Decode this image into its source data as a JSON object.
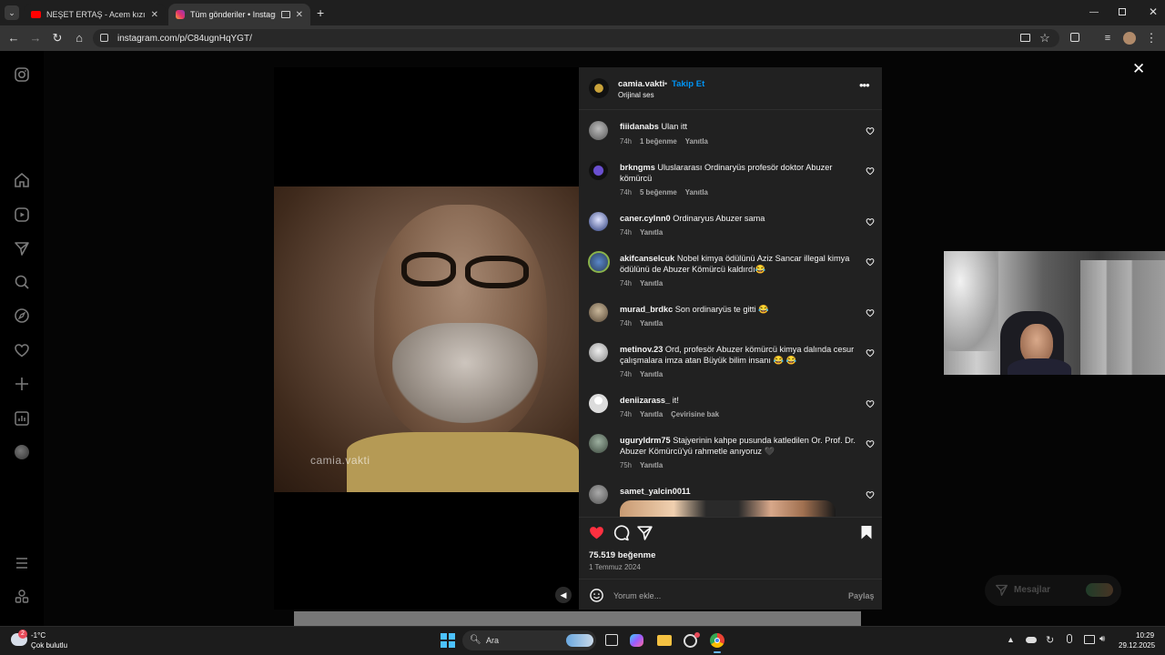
{
  "browser": {
    "tabs": [
      {
        "title": "NEŞET ERTAŞ - Acem kızı, Çırpın",
        "active": false
      },
      {
        "title": "Tüm gönderiler • Instagram",
        "active": true
      }
    ],
    "new_tab": "+",
    "url": "instagram.com/p/C84ugnHqYGT/"
  },
  "post": {
    "username": "camia.vakti",
    "separator": "•",
    "follow": "Takip Et",
    "audio": "Orijinal ses",
    "watermark": "camia.vakti",
    "likes": "75.519 beğenme",
    "date": "1 Temmuz 2024",
    "comment_placeholder": "Yorum ekle...",
    "share": "Paylaş"
  },
  "comments": [
    {
      "user": "fiiidanabs",
      "text": "Ulan itt",
      "time": "74h",
      "likes": "1 beğenme",
      "reply": "Yanıtla"
    },
    {
      "user": "brkngms",
      "text": "Uluslararası Ordinaryüs profesör doktor Abuzer kömürcü",
      "time": "74h",
      "likes": "5 beğenme",
      "reply": "Yanıtla"
    },
    {
      "user": "caner.cylnn0",
      "text": "Ordinaryus Abuzer sama",
      "time": "74h",
      "reply": "Yanıtla"
    },
    {
      "user": "akifcanselcuk",
      "text": "Nobel kimya ödülünü Aziz Sancar illegal kimya ödülünü de Abuzer Kömürcü kaldırdı😂",
      "time": "74h",
      "reply": "Yanıtla"
    },
    {
      "user": "murad_brdkc",
      "text": "Son ordinaryüs te gitti 😂",
      "time": "74h",
      "reply": "Yanıtla"
    },
    {
      "user": "metinov.23",
      "text": "Ord, profesör Abuzer kömürcü kimya dalında cesur çalışmalara imza atan Büyük bilim insanı 😂 😂",
      "time": "74h",
      "reply": "Yanıtla"
    },
    {
      "user": "deniizarass_",
      "text": "it!",
      "time": "74h",
      "reply": "Yanıtla",
      "translate": "Çevirisine bak"
    },
    {
      "user": "uguryldrm75",
      "text": "Stajyerinin kahpe pusunda katledilen Or. Prof. Dr. Abuzer Kömürcü'yü rahmetle anıyoruz 🖤",
      "time": "75h",
      "reply": "Yanıtla"
    },
    {
      "user": "samet_yalcin0011",
      "text": ""
    }
  ],
  "messages": {
    "label": "Mesajlar"
  },
  "taskbar": {
    "weather_temp": "-1°C",
    "weather_desc": "Çok bulutlu",
    "weather_badge": "2",
    "search": "Ara",
    "time": "10:29",
    "date": "29.12.2025"
  }
}
